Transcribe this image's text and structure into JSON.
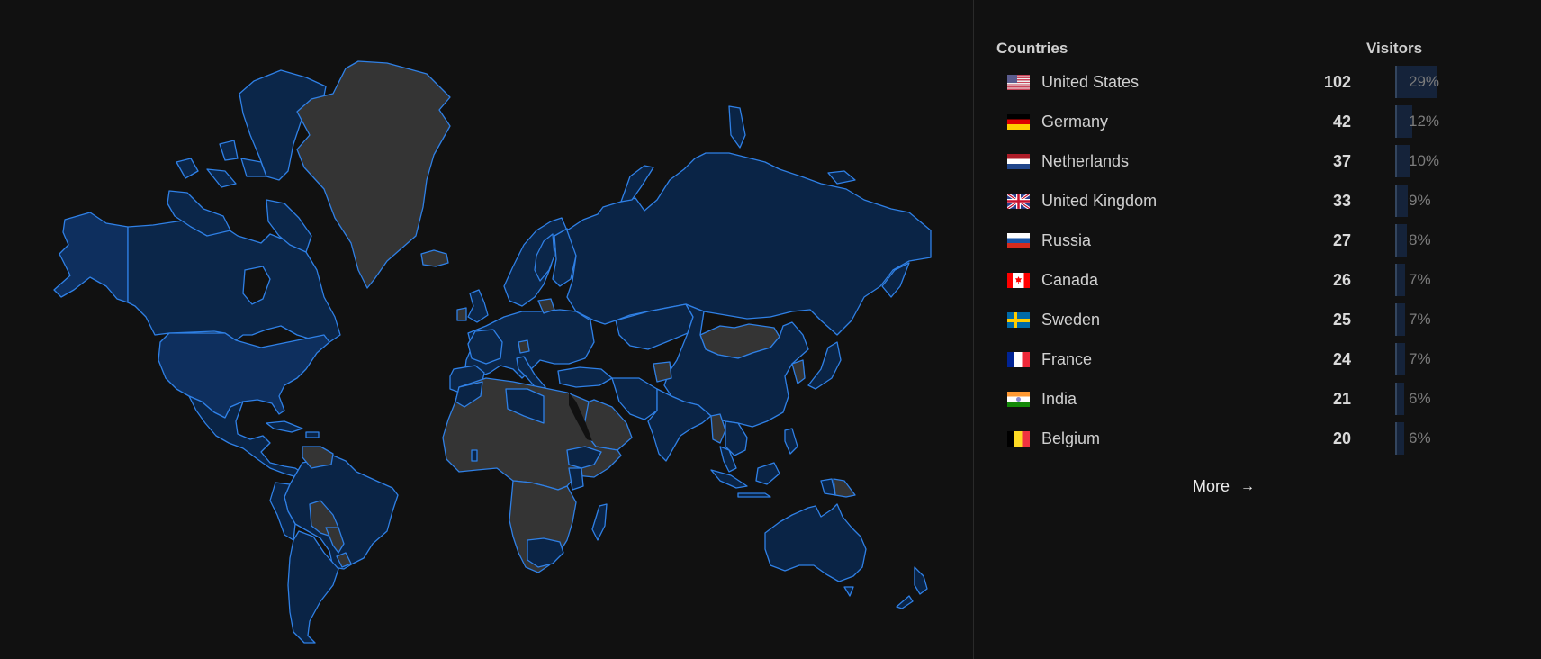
{
  "panel": {
    "header_countries": "Countries",
    "header_visitors": "Visitors",
    "more_label": "More",
    "more_icon": "→"
  },
  "colors": {
    "background": "#111111",
    "country_border": "#2f80e6",
    "country_high": "#0e2f5e",
    "country_low": "#0a2446",
    "country_no_data": "#343434",
    "bar": "#15233a"
  },
  "countries": [
    {
      "name": "United States",
      "flag": "us-flag",
      "visitors": "102",
      "percent": "29%",
      "share": 0.29
    },
    {
      "name": "Germany",
      "flag": "de-flag",
      "visitors": "42",
      "percent": "12%",
      "share": 0.12
    },
    {
      "name": "Netherlands",
      "flag": "nl-flag",
      "visitors": "37",
      "percent": "10%",
      "share": 0.1
    },
    {
      "name": "United Kingdom",
      "flag": "gb-flag",
      "visitors": "33",
      "percent": "9%",
      "share": 0.09
    },
    {
      "name": "Russia",
      "flag": "ru-flag",
      "visitors": "27",
      "percent": "8%",
      "share": 0.08
    },
    {
      "name": "Canada",
      "flag": "ca-flag",
      "visitors": "26",
      "percent": "7%",
      "share": 0.07
    },
    {
      "name": "Sweden",
      "flag": "se-flag",
      "visitors": "25",
      "percent": "7%",
      "share": 0.07
    },
    {
      "name": "France",
      "flag": "fr-flag",
      "visitors": "24",
      "percent": "7%",
      "share": 0.07
    },
    {
      "name": "India",
      "flag": "in-flag",
      "visitors": "21",
      "percent": "6%",
      "share": 0.06
    },
    {
      "name": "Belgium",
      "flag": "be-flag",
      "visitors": "20",
      "percent": "6%",
      "share": 0.06
    }
  ]
}
